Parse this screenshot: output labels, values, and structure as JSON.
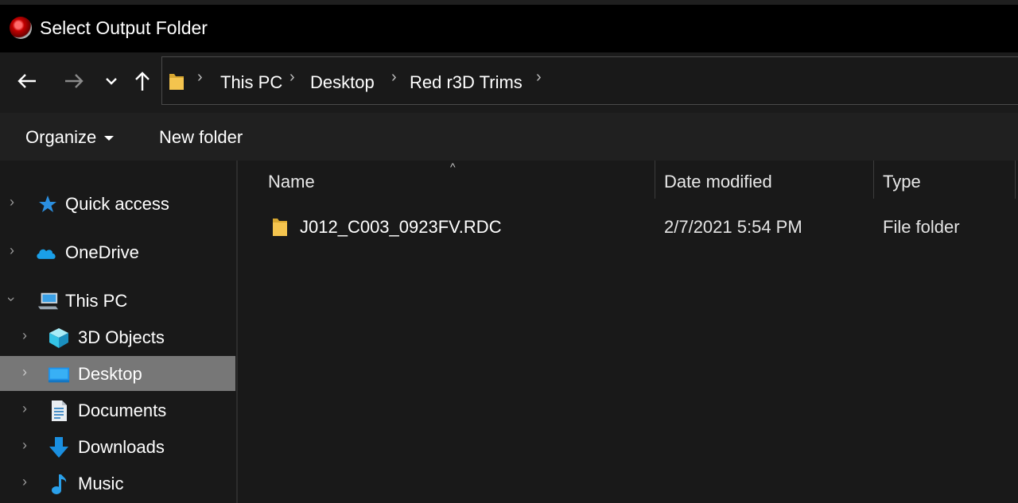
{
  "window": {
    "title": "Select Output Folder"
  },
  "navigation": {
    "back_icon": "arrow-left",
    "forward_icon": "arrow-right",
    "recent_icon": "chevron-down",
    "up_icon": "arrow-up",
    "breadcrumbs": [
      "This PC",
      "Desktop",
      "Red r3D Trims"
    ]
  },
  "toolbar": {
    "organize_label": "Organize",
    "new_folder_label": "New folder"
  },
  "sidebar": {
    "items": [
      {
        "label": "Quick access",
        "icon": "star-icon",
        "expanded": false
      },
      {
        "label": "OneDrive",
        "icon": "cloud-icon",
        "expanded": false
      },
      {
        "label": "This PC",
        "icon": "computer-icon",
        "expanded": true
      },
      {
        "label": "3D Objects",
        "icon": "cube-icon",
        "expanded": false
      },
      {
        "label": "Desktop",
        "icon": "desktop-icon",
        "expanded": false,
        "selected": true
      },
      {
        "label": "Documents",
        "icon": "document-icon",
        "expanded": false
      },
      {
        "label": "Downloads",
        "icon": "download-icon",
        "expanded": false
      },
      {
        "label": "Music",
        "icon": "music-note-icon",
        "expanded": false
      }
    ]
  },
  "file_list": {
    "columns": [
      "Name",
      "Date modified",
      "Type"
    ],
    "sort_column": "Name",
    "rows": [
      {
        "name": "J012_C003_0923FV.RDC",
        "date_modified": "2/7/2021 5:54 PM",
        "type": "File folder"
      }
    ]
  },
  "colors": {
    "background": "#191919",
    "titlebar": "#000000",
    "selected_item": "#777777",
    "folder_yellow": "#f4c44e",
    "accent_blue": "#1a9fe8"
  }
}
